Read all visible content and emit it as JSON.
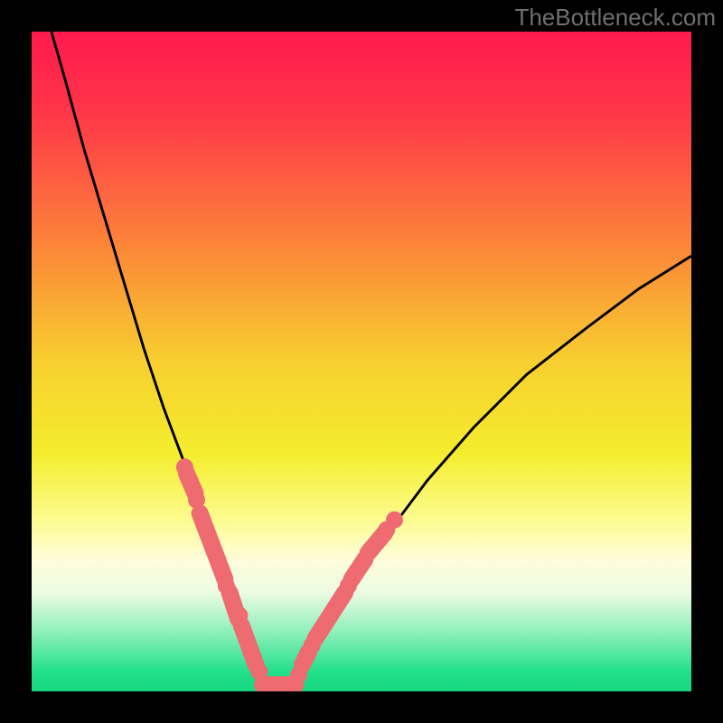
{
  "watermark": "TheBottleneck.com",
  "chart_data": {
    "type": "line",
    "title": "",
    "xlabel": "",
    "ylabel": "",
    "xlim": [
      0,
      100
    ],
    "ylim": [
      0,
      100
    ],
    "background_gradient": {
      "stops": [
        {
          "offset": 0,
          "color": "#ff1a4e"
        },
        {
          "offset": 12,
          "color": "#ff3549"
        },
        {
          "offset": 30,
          "color": "#fc7b3a"
        },
        {
          "offset": 50,
          "color": "#f7cf2f"
        },
        {
          "offset": 64,
          "color": "#f4ed2e"
        },
        {
          "offset": 74,
          "color": "#fdfc8f"
        },
        {
          "offset": 80,
          "color": "#fffddb"
        },
        {
          "offset": 85,
          "color": "#ecfbe2"
        },
        {
          "offset": 91,
          "color": "#8ff0ba"
        },
        {
          "offset": 97,
          "color": "#22e08a"
        },
        {
          "offset": 100,
          "color": "#16d67f"
        }
      ]
    },
    "series": [
      {
        "name": "bottleneck-curve-left",
        "x": [
          3,
          5,
          8,
          11,
          14,
          17,
          20,
          23,
          25,
          27,
          29,
          31,
          33,
          35,
          36.5
        ],
        "y": [
          100,
          93,
          82,
          72,
          62,
          52,
          43,
          35,
          28,
          22,
          16,
          11,
          7,
          3,
          0
        ]
      },
      {
        "name": "bottleneck-curve-right",
        "x": [
          36.5,
          38,
          40,
          42,
          45,
          49,
          54,
          60,
          67,
          75,
          84,
          92,
          100
        ],
        "y": [
          0,
          0,
          3,
          6,
          11,
          17,
          24,
          32,
          40,
          48,
          55,
          61,
          66
        ]
      }
    ],
    "highlight": {
      "color": "#ee6b72",
      "segments": [
        {
          "x": [
            23.5,
            24.8
          ],
          "y": [
            33.0,
            30.0
          ]
        },
        {
          "x": [
            25.5,
            29.3
          ],
          "y": [
            27.0,
            17.0
          ]
        },
        {
          "x": [
            30.0,
            31.3
          ],
          "y": [
            15.0,
            11.0
          ]
        },
        {
          "x": [
            31.8,
            34.0
          ],
          "y": [
            10.0,
            4.0
          ]
        },
        {
          "x": [
            35.0,
            40.0
          ],
          "y": [
            1.0,
            1.0
          ]
        },
        {
          "x": [
            41.0,
            42.0
          ],
          "y": [
            4.0,
            6.0
          ]
        },
        {
          "x": [
            43.0,
            47.5
          ],
          "y": [
            8.0,
            15.0
          ]
        },
        {
          "x": [
            48.5,
            50.5
          ],
          "y": [
            17.0,
            20.0
          ]
        },
        {
          "x": [
            51.0,
            53.5
          ],
          "y": [
            21.0,
            24.0
          ]
        }
      ],
      "dots": [
        {
          "x": 23.2,
          "y": 34.0
        },
        {
          "x": 25.0,
          "y": 29.0
        },
        {
          "x": 29.5,
          "y": 16.0
        },
        {
          "x": 31.5,
          "y": 11.5
        },
        {
          "x": 34.5,
          "y": 3.0
        },
        {
          "x": 40.5,
          "y": 2.5
        },
        {
          "x": 42.5,
          "y": 7.0
        },
        {
          "x": 48.0,
          "y": 16.0
        },
        {
          "x": 50.5,
          "y": 20.0
        },
        {
          "x": 53.8,
          "y": 24.5
        },
        {
          "x": 55.0,
          "y": 26.0
        }
      ]
    }
  }
}
